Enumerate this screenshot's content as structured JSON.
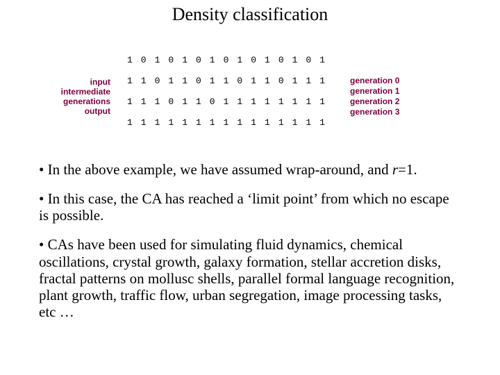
{
  "title": "Density classification",
  "rowLabels": {
    "r0": "input",
    "r1": "intermediate",
    "r2": "generations",
    "r3": "output"
  },
  "gridRows": {
    "g0": "101010101010101",
    "g1": "110110110110111",
    "g2": "111011011111111",
    "g3": "111111111111111"
  },
  "genLabels": {
    "gen0": "generation 0",
    "gen1": "generation 1",
    "gen2": "generation 2",
    "gen3": "generation 3"
  },
  "bullets": {
    "b1a": "• In the above example, we have assumed wrap-around, and ",
    "b1r": "r",
    "b1b": "=1.",
    "b2": "• In this case, the CA has reached a ‘limit point’ from which no escape is possible.",
    "b3": "• CAs have been used for simulating fluid dynamics, chemical oscillations, crystal growth, galaxy formation, stellar accretion disks, fractal patterns on mollusc shells, parallel formal language recognition, plant growth, traffic flow, urban segregation, image processing tasks, etc …"
  }
}
